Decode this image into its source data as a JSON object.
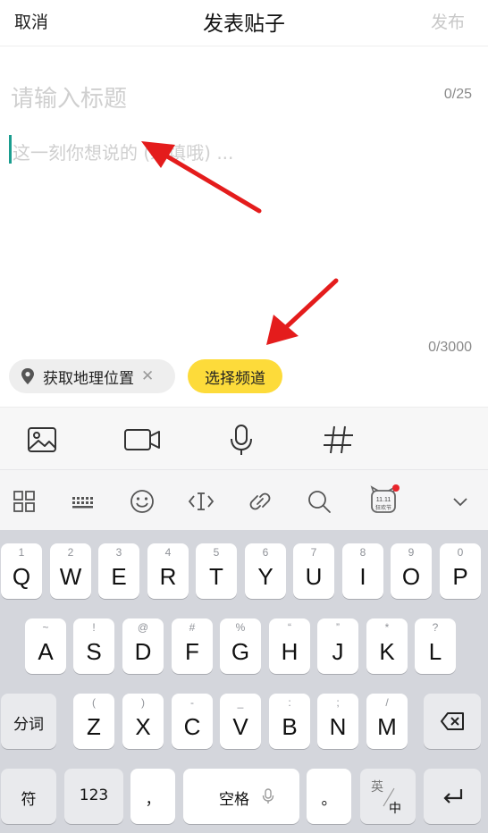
{
  "header": {
    "cancel_label": "取消",
    "title": "发表贴子",
    "publish_label": "发布"
  },
  "editor": {
    "title_placeholder": "请输入标题",
    "title_count": "0/25",
    "body_placeholder": "这一刻你想说的 (必填哦) ...",
    "body_count": "0/3000"
  },
  "chips": {
    "location_label": "获取地理位置",
    "location_close": "✕",
    "channel_label": "选择频道"
  },
  "media_bar": {
    "items": [
      "image-icon",
      "video-icon",
      "microphone-icon",
      "hashtag-icon"
    ]
  },
  "keyboard_toolbar": {
    "items": [
      "grid-menu-icon",
      "keyboard-icon",
      "emoji-icon",
      "cursor-move-icon",
      "clipboard-link-icon",
      "search-icon",
      "double-eleven-festival-icon",
      "chevron-down-icon"
    ],
    "festival_badge_text": "狂欢节",
    "festival_badge_date": "11.11"
  },
  "keyboard": {
    "row1": [
      {
        "hint": "1",
        "key": "Q"
      },
      {
        "hint": "2",
        "key": "W"
      },
      {
        "hint": "3",
        "key": "E"
      },
      {
        "hint": "4",
        "key": "R"
      },
      {
        "hint": "5",
        "key": "T"
      },
      {
        "hint": "6",
        "key": "Y"
      },
      {
        "hint": "7",
        "key": "U"
      },
      {
        "hint": "8",
        "key": "I"
      },
      {
        "hint": "9",
        "key": "O"
      },
      {
        "hint": "0",
        "key": "P"
      }
    ],
    "row2": [
      {
        "hint": "~",
        "key": "A"
      },
      {
        "hint": "!",
        "key": "S"
      },
      {
        "hint": "@",
        "key": "D"
      },
      {
        "hint": "#",
        "key": "F"
      },
      {
        "hint": "%",
        "key": "G"
      },
      {
        "hint": "“",
        "key": "H"
      },
      {
        "hint": "”",
        "key": "J"
      },
      {
        "hint": "*",
        "key": "K"
      },
      {
        "hint": "?",
        "key": "L"
      }
    ],
    "row3": [
      {
        "hint": "(",
        "key": "Z"
      },
      {
        "hint": ")",
        "key": "X"
      },
      {
        "hint": "-",
        "key": "C"
      },
      {
        "hint": "_",
        "key": "V"
      },
      {
        "hint": ":",
        "key": "B"
      },
      {
        "hint": ";",
        "key": "N"
      },
      {
        "hint": "/",
        "key": "M"
      }
    ],
    "segment_label": "分词",
    "symbol_label": "符",
    "numbers_label": "123",
    "comma_label": "，",
    "space_label": "空格",
    "period_label": "。",
    "lang_top": "英",
    "lang_bottom": "中",
    "accent_color": "#fddb3a",
    "badge_color": "#e8242b"
  }
}
